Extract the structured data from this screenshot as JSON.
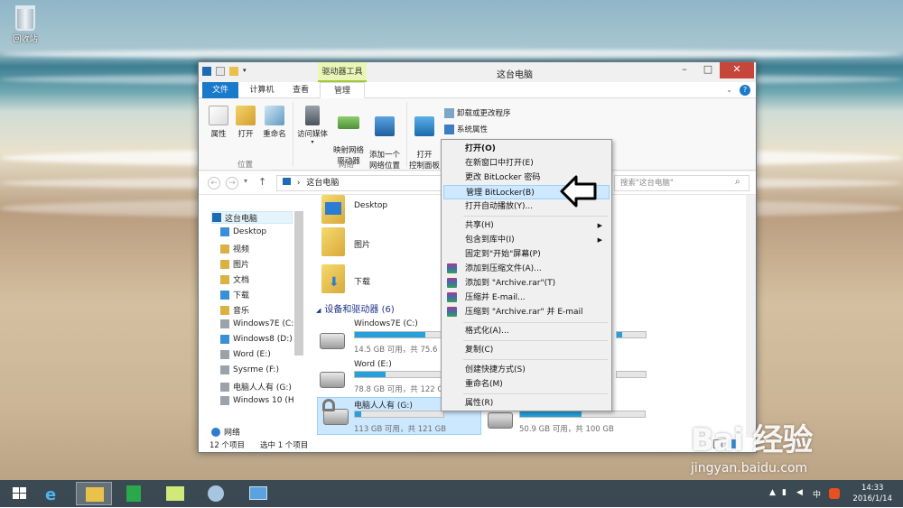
{
  "desktop": {
    "recycle_bin_label": "回收站"
  },
  "window": {
    "title": "这台电脑",
    "context_tab": "驱动器工具",
    "tabs": [
      "文件",
      "计算机",
      "查看",
      "管理"
    ],
    "ribbon": {
      "location_group": {
        "label": "位置",
        "buttons": [
          "属性",
          "打开",
          "重命名"
        ]
      },
      "network_group": {
        "label": "网络",
        "buttons": [
          "访问媒体",
          "映射网络\n驱动器",
          "添加一个\n网络位置"
        ]
      },
      "system_buttons": {
        "control_panel": "打开\n控制面板",
        "uninstall": "卸载或更改程序",
        "properties": "系统属性"
      }
    },
    "address": {
      "path": "这台电脑",
      "search_placeholder": "搜索\"这台电脑\""
    },
    "nav_items": [
      "这台电脑",
      "Desktop",
      "视频",
      "图片",
      "文档",
      "下载",
      "音乐",
      "Windows7E (C:)",
      "Windows8 (D:)",
      "Word (E:)",
      "Sysrme (F:)",
      "电脑人人有 (G:)",
      "Windows 10 (H",
      "网络"
    ],
    "folders": [
      "Desktop",
      "图片",
      "下载"
    ],
    "section_title": "设备和驱动器 (6)",
    "drives": [
      {
        "name": "Windows7E (C:)",
        "size": "14.5 GB 可用，共 75.6",
        "fill": 0.8
      },
      {
        "name": "Word (E:)",
        "size": "78.8 GB 可用，共 122 GB",
        "fill": 0.35
      },
      {
        "name": "电脑人人有 (G:)",
        "size": "113 GB 可用，共 121 GB",
        "fill": 0.07
      },
      {
        "name": "",
        "size": "50.9 GB 可用，共 100 GB",
        "fill": 0.49
      }
    ],
    "status": {
      "items": "12 个项目",
      "selected": "选中 1 个项目"
    }
  },
  "context_menu": [
    {
      "label": "打开(O)",
      "bold": true
    },
    {
      "label": "在新窗口中打开(E)"
    },
    {
      "label": "更改 BitLocker 密码"
    },
    {
      "label": "管理 BitLocker(B)",
      "highlighted": true
    },
    {
      "label": "打开自动播放(Y)..."
    },
    {
      "label": "共享(H)",
      "submenu": true
    },
    {
      "label": "包含到库中(I)",
      "submenu": true
    },
    {
      "label": "固定到\"开始\"屏幕(P)"
    },
    {
      "label": "添加到压缩文件(A)...",
      "icon": "winrar-icon"
    },
    {
      "label": "添加到 \"Archive.rar\"(T)",
      "icon": "winrar-icon"
    },
    {
      "label": "压缩并 E-mail...",
      "icon": "winrar-icon"
    },
    {
      "label": "压缩到 \"Archive.rar\" 并 E-mail",
      "icon": "winrar-icon"
    },
    {
      "label": "格式化(A)..."
    },
    {
      "label": "复制(C)"
    },
    {
      "label": "创建快捷方式(S)"
    },
    {
      "label": "重命名(M)"
    },
    {
      "label": "属性(R)"
    }
  ],
  "taskbar": {
    "time": "14:33",
    "date": "2016/1/14",
    "ime": "中"
  },
  "watermark": {
    "logo": "Bai 经验",
    "url": "jingyan.baidu.com"
  }
}
